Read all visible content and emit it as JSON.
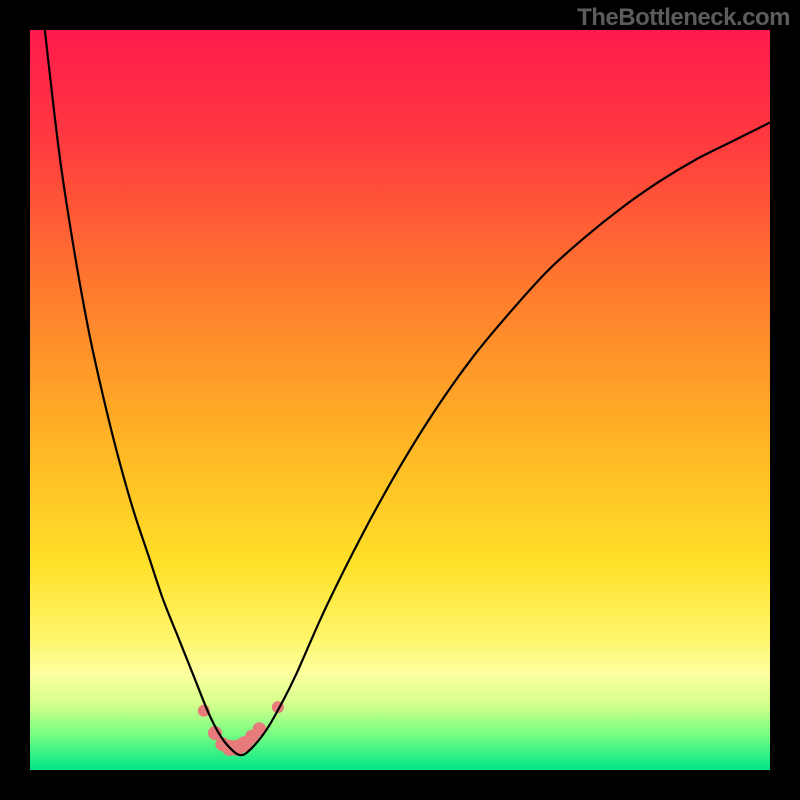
{
  "watermark": "TheBottleneck.com",
  "chart_data": {
    "type": "line",
    "title": "",
    "xlabel": "",
    "ylabel": "",
    "xlim": [
      0,
      100
    ],
    "ylim": [
      0,
      100
    ],
    "background_gradient": {
      "stops": [
        {
          "pos": 0.0,
          "color": "#ff1a4d"
        },
        {
          "pos": 0.15,
          "color": "#ff3a3f"
        },
        {
          "pos": 0.35,
          "color": "#ff7a2e"
        },
        {
          "pos": 0.55,
          "color": "#ffb325"
        },
        {
          "pos": 0.72,
          "color": "#ffe028"
        },
        {
          "pos": 0.82,
          "color": "#fff56a"
        },
        {
          "pos": 0.87,
          "color": "#fdffa0"
        },
        {
          "pos": 0.91,
          "color": "#d6ff8c"
        },
        {
          "pos": 0.95,
          "color": "#7aff82"
        },
        {
          "pos": 1.0,
          "color": "#00e58a"
        }
      ]
    },
    "series": [
      {
        "name": "main-curve",
        "color": "#000000",
        "x": [
          2,
          4,
          6,
          8,
          10,
          12,
          14,
          16,
          18,
          20,
          22,
          24,
          25.5,
          27,
          28.5,
          30,
          32,
          34,
          36,
          40,
          45,
          50,
          55,
          60,
          65,
          70,
          75,
          80,
          85,
          90,
          95,
          100
        ],
        "y": [
          100,
          83,
          70,
          59,
          50,
          42,
          35,
          29,
          23,
          18,
          13,
          8,
          5,
          3,
          2,
          3,
          5.5,
          9,
          13,
          22,
          32,
          41,
          49,
          56,
          62,
          67.5,
          72,
          76,
          79.5,
          82.5,
          85,
          87.5
        ]
      }
    ],
    "scatter": {
      "name": "trough-points",
      "color": "#e77b7b",
      "points": [
        {
          "x": 23.5,
          "y": 8.0,
          "r": 6
        },
        {
          "x": 25.0,
          "y": 5.0,
          "r": 7
        },
        {
          "x": 26.0,
          "y": 3.5,
          "r": 7
        },
        {
          "x": 27.0,
          "y": 3.0,
          "r": 8
        },
        {
          "x": 28.0,
          "y": 3.0,
          "r": 8
        },
        {
          "x": 29.0,
          "y": 3.5,
          "r": 8
        },
        {
          "x": 30.0,
          "y": 4.5,
          "r": 7
        },
        {
          "x": 31.0,
          "y": 5.5,
          "r": 7
        },
        {
          "x": 33.5,
          "y": 8.5,
          "r": 6
        }
      ]
    }
  }
}
